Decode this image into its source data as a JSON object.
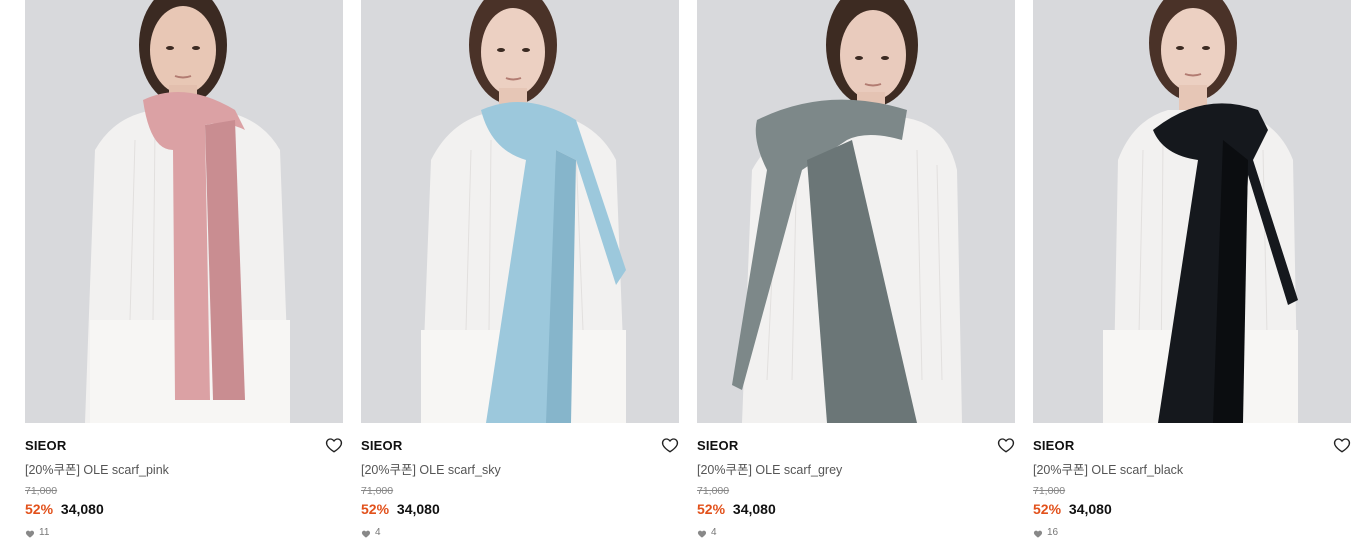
{
  "products": [
    {
      "brand": "SIEOR",
      "title": "[20%쿠폰] OLE scarf_pink",
      "original_price": "71,000",
      "discount": "52%",
      "price": "34,080",
      "likes": "11",
      "scarf_color": "#dba1a4",
      "scarf_shade": "#c98d91"
    },
    {
      "brand": "SIEOR",
      "title": "[20%쿠폰] OLE scarf_sky",
      "original_price": "71,000",
      "discount": "52%",
      "price": "34,080",
      "likes": "4",
      "scarf_color": "#9cc8dc",
      "scarf_shade": "#86b5cb"
    },
    {
      "brand": "SIEOR",
      "title": "[20%쿠폰] OLE scarf_grey",
      "original_price": "71,000",
      "discount": "52%",
      "price": "34,080",
      "likes": "4",
      "scarf_color": "#7d8889",
      "scarf_shade": "#6b7677"
    },
    {
      "brand": "SIEOR",
      "title": "[20%쿠폰] OLE scarf_black",
      "original_price": "71,000",
      "discount": "52%",
      "price": "34,080",
      "likes": "16",
      "scarf_color": "#15181d",
      "scarf_shade": "#0b0d10"
    }
  ],
  "colors": {
    "discount": "#e2511b",
    "photo_background": "#d8d9dc"
  },
  "icons": {
    "wishlist": "heart-outline-icon",
    "likes": "heart-filled-icon"
  }
}
